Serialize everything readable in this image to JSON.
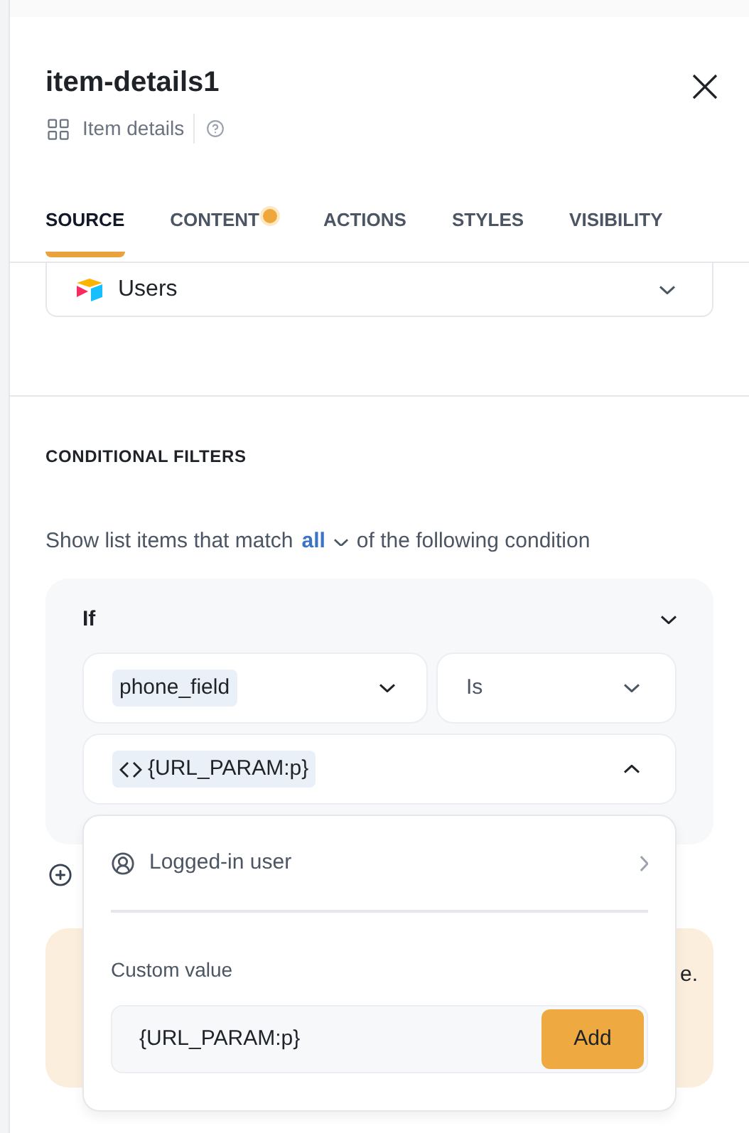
{
  "header": {
    "title": "item-details1",
    "subtitle": "Item details"
  },
  "tabs": [
    {
      "label": "SOURCE",
      "selected": true,
      "dot": false
    },
    {
      "label": "CONTENT",
      "selected": false,
      "dot": true
    },
    {
      "label": "ACTIONS",
      "selected": false,
      "dot": false
    },
    {
      "label": "STYLES",
      "selected": false,
      "dot": false
    },
    {
      "label": "VISIBILITY",
      "selected": false,
      "dot": false
    }
  ],
  "source_select": {
    "value": "Users"
  },
  "filters": {
    "heading": "CONDITIONAL FILTERS",
    "sentence_start": "Show list items that match",
    "match": "all",
    "sentence_end": "of the following condition",
    "condition": {
      "label": "If",
      "expanded": true,
      "field": "phone_field",
      "operator": "Is",
      "value": "{URL_PARAM:p}",
      "value_open": true
    }
  },
  "warning": {
    "text": "e."
  },
  "popover": {
    "option": "Logged-in user",
    "custom_label": "Custom value",
    "custom_value": "{URL_PARAM:p}",
    "add_button": "Add"
  }
}
